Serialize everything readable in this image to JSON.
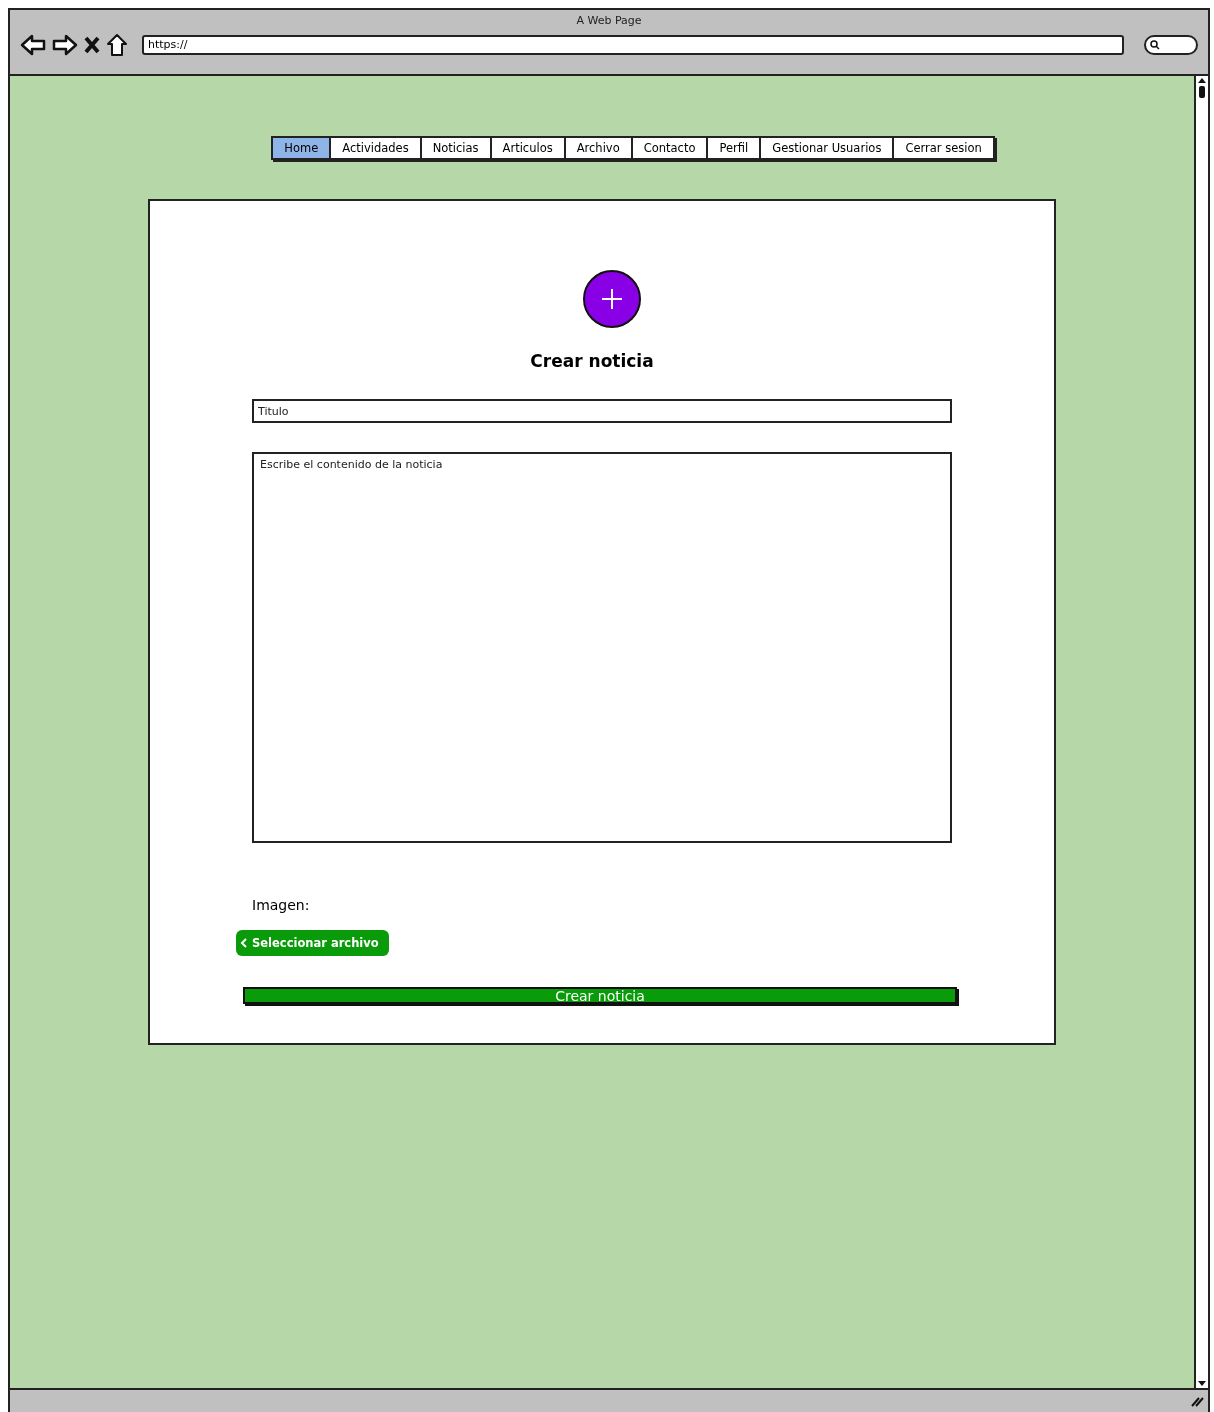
{
  "window": {
    "title": "A Web Page",
    "url": "https://"
  },
  "nav": [
    {
      "label": "Home",
      "selected": true
    },
    {
      "label": "Actividades",
      "selected": false
    },
    {
      "label": "Noticias",
      "selected": false
    },
    {
      "label": "Articulos",
      "selected": false
    },
    {
      "label": "Archivo",
      "selected": false
    },
    {
      "label": "Contacto",
      "selected": false
    },
    {
      "label": "Perfil",
      "selected": false
    },
    {
      "label": "Gestionar Usuarios",
      "selected": false
    },
    {
      "label": "Cerrar sesion",
      "selected": false
    }
  ],
  "form": {
    "heading": "Crear noticia",
    "title_field": {
      "placeholder": "Titulo"
    },
    "content_field": {
      "placeholder": "Escribe el contenido de la noticia"
    },
    "image_label": "Imagen:",
    "file_button": "Seleccionar archivo",
    "submit_button": "Crear noticia"
  }
}
